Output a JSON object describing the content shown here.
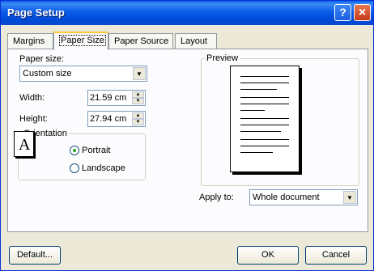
{
  "window": {
    "title": "Page Setup"
  },
  "titlebar": {
    "help_glyph": "?",
    "close_glyph": "×"
  },
  "tabs": [
    {
      "label": "Margins"
    },
    {
      "label": "Paper Size"
    },
    {
      "label": "Paper Source"
    },
    {
      "label": "Layout"
    }
  ],
  "paper_size": {
    "label": "Paper size:",
    "value": "Custom size"
  },
  "width": {
    "label": "Width:",
    "value": "21.59 cm"
  },
  "height": {
    "label": "Height:",
    "value": "27.94 cm"
  },
  "orientation": {
    "title": "Orientation",
    "icon_letter": "A",
    "portrait_label": "Portrait",
    "landscape_label": "Landscape",
    "selected": "Portrait"
  },
  "preview": {
    "title": "Preview"
  },
  "apply_to": {
    "label": "Apply to:",
    "value": "Whole document"
  },
  "buttons": {
    "default": "Default...",
    "ok": "OK",
    "cancel": "Cancel"
  }
}
